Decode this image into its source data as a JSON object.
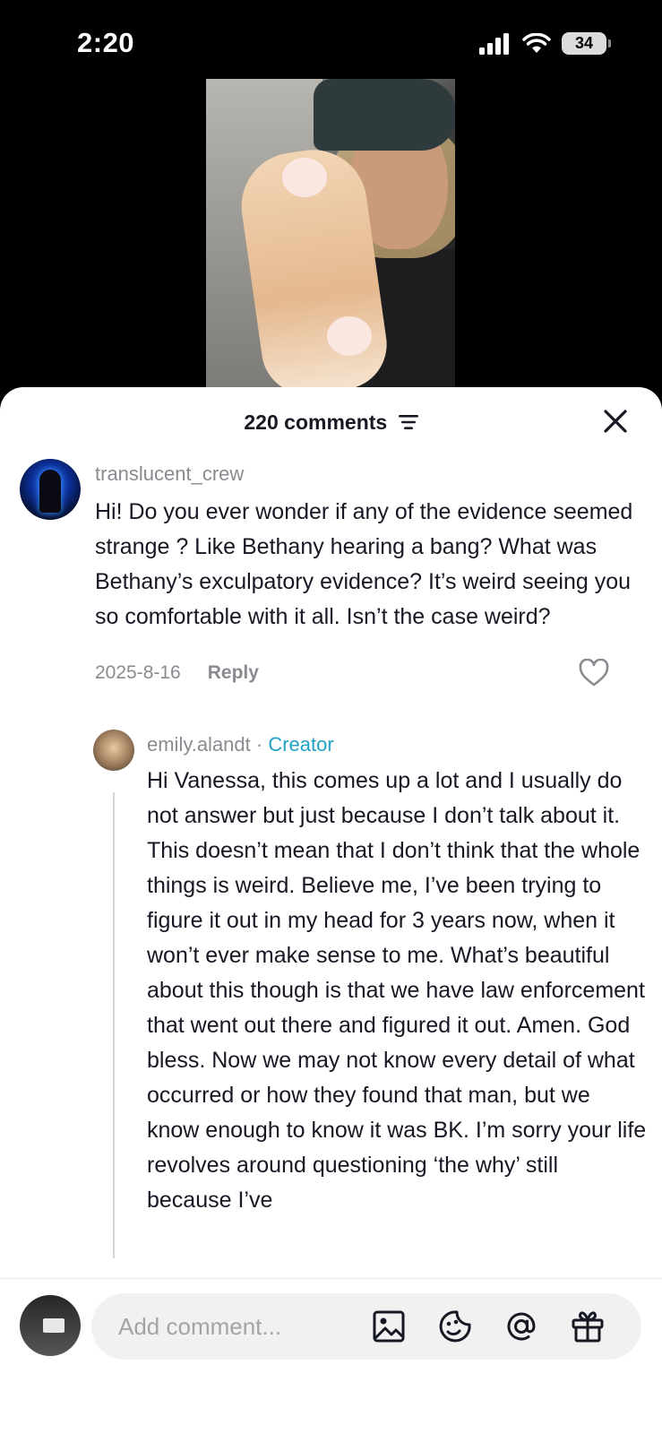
{
  "status_bar": {
    "time": "2:20",
    "battery": "34"
  },
  "sheet": {
    "comment_count_label": "220 comments"
  },
  "comment": {
    "username": "translucent_crew",
    "text": "Hi! Do you ever wonder if any of the evidence seemed strange ? Like Bethany hearing a bang? What was Bethany’s exculpatory evidence? It’s weird seeing you so comfortable with it all. Isn’t the case weird?",
    "date": "2025-8-16",
    "reply_label": "Reply"
  },
  "reply": {
    "username": "emily.alandt",
    "separator": " · ",
    "badge": "Creator",
    "text": "Hi Vanessa, this comes up a lot and I usually do not answer but just because I don’t talk about it. This doesn’t mean that I don’t think that the whole things is weird. Believe me, I’ve been trying to figure it out in my head for 3 years now, when it won’t ever make sense to me. What’s beautiful about this though is that we have law enforcement that went out there and figured it out. Amen. God bless. Now we may not know every detail of what occurred or how they found that man, but we know enough to know it was BK. I’m sorry your life revolves around questioning ‘the why’ still because I’ve"
  },
  "input_bar": {
    "placeholder": "Add comment...",
    "icons": [
      "image-icon",
      "sticker-icon",
      "mention-icon",
      "gift-icon"
    ]
  },
  "colors": {
    "creator_badge": "#20a3c4",
    "muted_text": "#8a8b91",
    "primary_text": "#161823"
  }
}
